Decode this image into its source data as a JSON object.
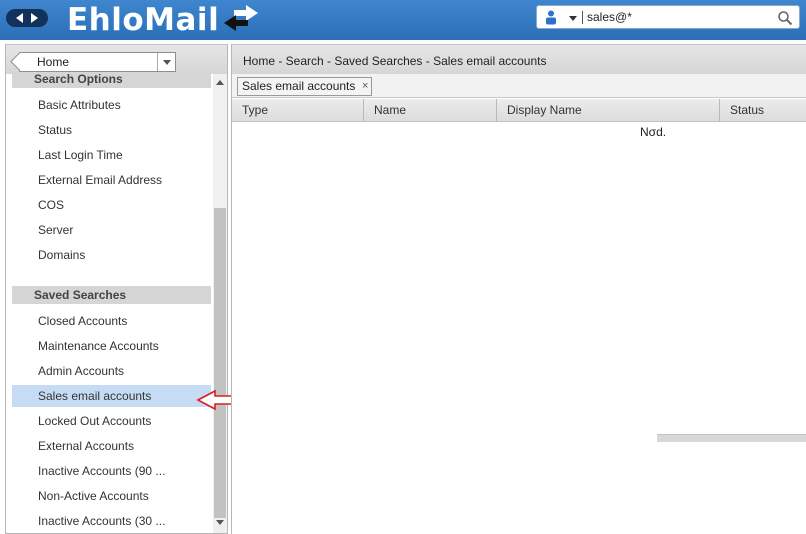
{
  "header": {
    "logo_text": "EhloMail",
    "search": {
      "value": "sales@*",
      "placeholder": ""
    },
    "icons": [
      "nav-back-icon",
      "nav-forward-icon",
      "logo-arrows-icon",
      "person-icon",
      "magnifier-icon"
    ]
  },
  "left": {
    "home_label": "Home",
    "search_options": {
      "title": "Search Options",
      "items": [
        "Basic Attributes",
        "Status",
        "Last Login Time",
        "External Email Address",
        "COS",
        "Server",
        "Domains"
      ]
    },
    "saved_searches": {
      "title": "Saved Searches",
      "items": [
        "Closed Accounts",
        "Maintenance Accounts",
        "Admin Accounts",
        "Sales email accounts",
        "Locked Out Accounts",
        "External Accounts",
        "Inactive Accounts (90 ...",
        "Non-Active Accounts",
        "Inactive Accounts (30 ..."
      ],
      "selected": "Sales email accounts"
    }
  },
  "right": {
    "breadcrumb": "Home - Search - Saved Searches - Sales email accounts",
    "tab_label": "Sales email accounts",
    "tab_close": "×",
    "columns": [
      "Type",
      "Name",
      "Display Name",
      "Status"
    ],
    "empty_message": "Nσd."
  },
  "colors": {
    "topbar": "#2f7bc4",
    "selected": "#c6dcf5",
    "annotation_arrow": "#d62020"
  }
}
